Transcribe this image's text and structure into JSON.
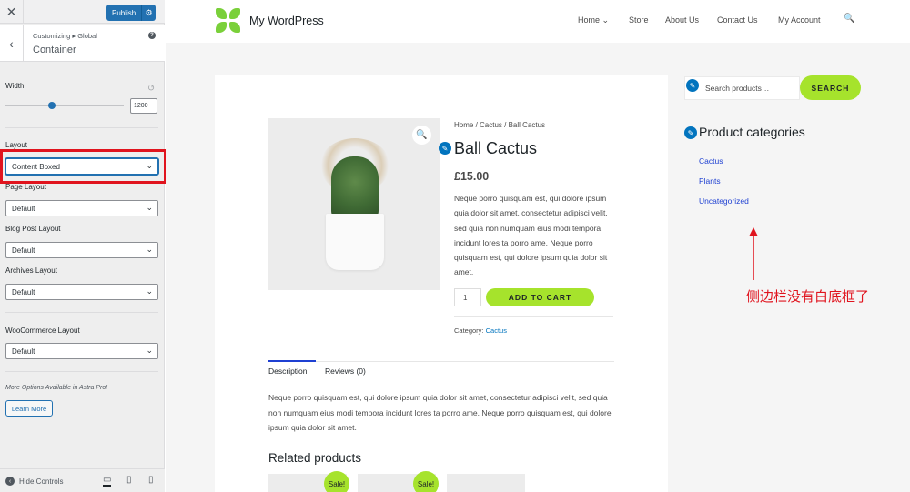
{
  "customizer": {
    "close_glyph": "✕",
    "publish_label": "Publish",
    "gear_glyph": "⚙",
    "back_glyph": "‹",
    "breadcrumb": "Customizing ▸ Global",
    "section_title": "Container",
    "help_glyph": "?",
    "width": {
      "label": "Width",
      "value": "1200",
      "slider_fraction": 0.39,
      "reset_glyph": "↺"
    },
    "layout_label": "Layout",
    "layout_value": "Content Boxed",
    "page_layout_label": "Page Layout",
    "page_layout_value": "Default",
    "blog_post_layout_label": "Blog Post Layout",
    "blog_post_layout_value": "Default",
    "archives_layout_label": "Archives Layout",
    "archives_layout_value": "Default",
    "woo_layout_label": "WooCommerce Layout",
    "woo_layout_value": "Default",
    "pro_note": "More Options Available in Astra Pro!",
    "learn_more_label": "Learn More",
    "hide_controls_label": "Hide Controls",
    "chevron_glyph": "⌄",
    "device_icons": [
      "desktop-icon",
      "tablet-icon",
      "mobile-icon"
    ],
    "highlight_color": "#e0141e"
  },
  "site": {
    "title": "My WordPress",
    "nav": [
      "Home ⌄",
      "Store",
      "About Us",
      "Contact Us",
      "My Account"
    ],
    "search_glyph": "🔍",
    "accent_color": "#a6e32c",
    "link_color": "#1e40d2"
  },
  "product": {
    "breadcrumb": "Home / Cactus / Ball Cactus",
    "title": "Ball Cactus",
    "price": "£15.00",
    "short_description": "Neque porro quisquam est, qui dolore ipsum quia dolor sit amet, consectetur adipisci velit, sed quia non numquam eius modi tempora incidunt lores ta porro ame. Neque porro quisquam est, qui dolore ipsum quia dolor sit amet.",
    "quantity": "1",
    "add_to_cart_label": "ADD TO CART",
    "category_label": "Category:",
    "category_value": "Cactus",
    "zoom_glyph": "🔍",
    "edit_glyph": "✎",
    "tabs": [
      "Description",
      "Reviews (0)"
    ],
    "long_description": "Neque porro quisquam est, qui dolore ipsum quia dolor sit amet, consectetur adipisci velit, sed quia non numquam eius modi tempora incidunt lores ta porro ame. Neque porro quisquam est, qui dolore ipsum quia dolor sit amet.",
    "related_title": "Related products",
    "sale_badge": "Sale!"
  },
  "sidebar": {
    "search_placeholder": "Search products…",
    "search_button": "SEARCH",
    "categories_title": "Product categories",
    "categories": [
      "Cactus",
      "Plants",
      "Uncategorized"
    ]
  },
  "annotation": {
    "text": "侧边栏没有白底框了"
  }
}
